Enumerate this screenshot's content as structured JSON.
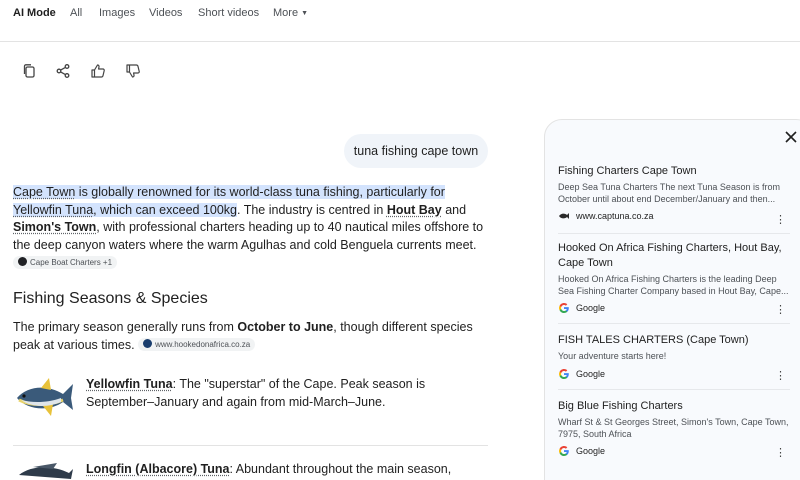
{
  "tabs": [
    "AI Mode",
    "All",
    "Images",
    "Videos",
    "Short videos",
    "More"
  ],
  "query": "tuna fishing cape town",
  "answer": {
    "p1_a": "Cape Town",
    "p1_b": " is globally renowned for its world-class tuna fishing, particularly for ",
    "p1_c": "Yellowfin Tuna",
    "p1_d": ", which can exceed 100kg",
    "p1_e": ". The industry is centred in ",
    "p1_f": "Hout Bay",
    "p1_g": " and ",
    "p1_h": "Simon's Town",
    "p1_i": ", with professional charters heading up to 40 nautical miles offshore to the deep canyon waters where the warm Agulhas and cold Benguela currents meet.",
    "chip1": "Cape Boat Charters +1"
  },
  "section_title": "Fishing Seasons & Species",
  "para2": {
    "a": "The primary season generally runs from ",
    "b": "October to June",
    "c": ", though different species peak at various times.",
    "chip": "www.hookedonafrica.co.za"
  },
  "species": [
    {
      "name": "Yellowfin Tuna",
      "desc": ": The \"superstar\" of the Cape. Peak season is September–January and again from mid-March–June."
    },
    {
      "name": "Longfin (Albacore) Tuna",
      "desc": ": Abundant throughout the main season,"
    }
  ],
  "sources": [
    {
      "title": "Fishing Charters Cape Town",
      "snippet": "Deep Sea Tuna Charters The next Tuna Season is from October until about end December/January and then...",
      "site": "www.captuna.co.za",
      "icon": "fish-favicon"
    },
    {
      "title": "Hooked On Africa Fishing Charters, Hout Bay, Cape Town",
      "snippet": "Hooked On Africa Fishing Charters is the leading Deep Sea Fishing Charter Company based in Hout Bay, Cape...",
      "site": "Google",
      "icon": "google-icon"
    },
    {
      "title": "FISH TALES CHARTERS (Cape Town)",
      "snippet": "Your adventure starts here!",
      "site": "Google",
      "icon": "google-icon"
    },
    {
      "title": "Big Blue Fishing Charters",
      "snippet": "Wharf St & St Georges Street, Simon's Town, Cape Town, 7975, South Africa",
      "site": "Google",
      "icon": "google-icon"
    }
  ],
  "colors": {
    "highlight": "#d3e3fd",
    "bubble": "#f0f4f9",
    "panel": "#f8fafd"
  }
}
